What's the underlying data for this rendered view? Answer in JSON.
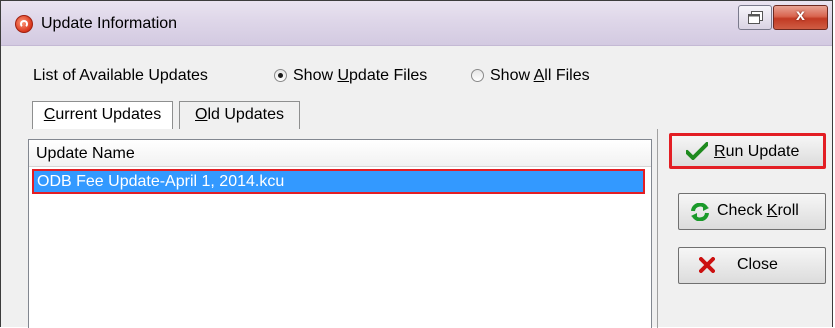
{
  "window": {
    "title": "Update Information",
    "close_glyph": "x"
  },
  "toolbar": {
    "label": "List of Available Updates",
    "options": [
      {
        "pre": "Show ",
        "key": "U",
        "post": "pdate Files",
        "checked": true
      },
      {
        "pre": "Show ",
        "key": "A",
        "post": "ll Files",
        "checked": false
      }
    ]
  },
  "tabs": [
    {
      "key": "C",
      "post": "urrent Updates",
      "active": true
    },
    {
      "key": "O",
      "post": "ld Updates",
      "active": false
    }
  ],
  "list": {
    "header": "Update Name",
    "items": [
      "ODB Fee Update-April 1, 2014.kcu"
    ]
  },
  "buttons": {
    "run": {
      "key": "R",
      "post": "un Update",
      "icon": "checkmark-icon"
    },
    "check": {
      "pre": "Check ",
      "key": "K",
      "post": "roll",
      "icon": "refresh-icon"
    },
    "close": {
      "label": "Close",
      "icon": "x-icon"
    }
  },
  "colors": {
    "selection": "#3399ff",
    "highlight_outline": "#e31e24"
  }
}
